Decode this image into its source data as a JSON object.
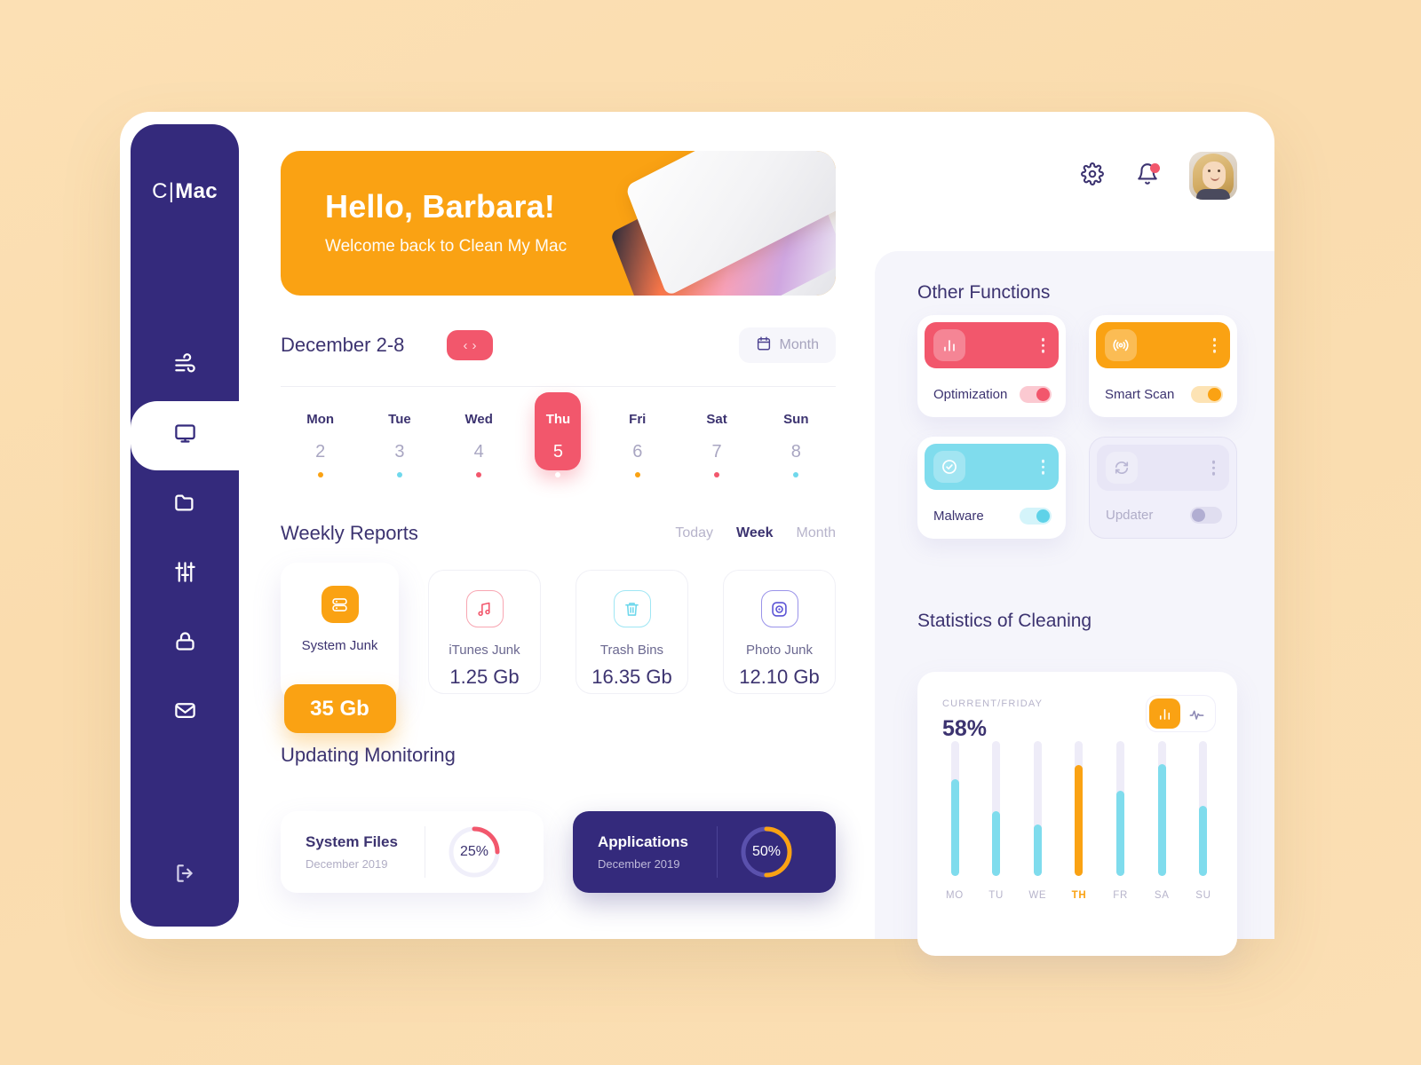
{
  "brand": {
    "prefix": "C",
    "divider": "|",
    "suffix": "Mac"
  },
  "sidebar": {
    "items": [
      {
        "name": "wind-icon",
        "label": "Airflow"
      },
      {
        "name": "monitor-icon",
        "label": "Dashboard"
      },
      {
        "name": "folder-icon",
        "label": "Files"
      },
      {
        "name": "sliders-icon",
        "label": "Settings"
      },
      {
        "name": "lock-icon",
        "label": "Security"
      },
      {
        "name": "mail-icon",
        "label": "Mail"
      }
    ],
    "logout_label": "Log out"
  },
  "banner": {
    "greeting": "Hello, Barbara!",
    "subtitle": "Welcome back to Clean My Mac"
  },
  "topbar": {
    "settings_label": "Settings",
    "notifications_label": "Notifications",
    "avatar_label": "Barbara"
  },
  "date_nav": {
    "range": "December 2-8",
    "prev": "‹",
    "next": "›",
    "month_button": "Month"
  },
  "week": {
    "days": [
      {
        "name": "Mon",
        "num": "2",
        "dot": "#faa213",
        "selected": false
      },
      {
        "name": "Tue",
        "num": "3",
        "dot": "#6fd8ec",
        "selected": false
      },
      {
        "name": "Wed",
        "num": "4",
        "dot": "#f2576c",
        "selected": false
      },
      {
        "name": "Thu",
        "num": "5",
        "dot": "#ffffff",
        "selected": true
      },
      {
        "name": "Fri",
        "num": "6",
        "dot": "#faa213",
        "selected": false
      },
      {
        "name": "Sat",
        "num": "7",
        "dot": "#f2576c",
        "selected": false
      },
      {
        "name": "Sun",
        "num": "8",
        "dot": "#6fd8ec",
        "selected": false
      }
    ]
  },
  "weekly_reports": {
    "title": "Weekly Reports",
    "tabs": [
      {
        "label": "Today",
        "active": false
      },
      {
        "label": "Week",
        "active": true
      },
      {
        "label": "Month",
        "active": false
      }
    ],
    "cards": [
      {
        "label": "System Junk",
        "value": "35 Gb",
        "icon": "server-icon",
        "color": "#faa213",
        "highlight": true
      },
      {
        "label": "iTunes Junk",
        "value": "1.25 Gb",
        "icon": "music-note-icon",
        "color": "#f2576c",
        "highlight": false
      },
      {
        "label": "Trash Bins",
        "value": "16.35 Gb",
        "icon": "trash-icon",
        "color": "#6fd8ec",
        "highlight": false
      },
      {
        "label": "Photo Junk",
        "value": "12.10 Gb",
        "icon": "camera-icon",
        "color": "#5a52d5",
        "highlight": false
      }
    ]
  },
  "updating_monitoring": {
    "title": "Updating Monitoring",
    "cards": [
      {
        "title": "System Files",
        "subtitle": "December 2019",
        "percent": 25,
        "percent_label": "25%",
        "arc_color": "#f2576c",
        "track_color": "#f0effa",
        "theme": "light"
      },
      {
        "title": "Applications",
        "subtitle": "December 2019",
        "percent": 50,
        "percent_label": "50%",
        "arc_color": "#faa213",
        "track_color": "#5a51ad",
        "theme": "dark"
      }
    ]
  },
  "other_functions": {
    "title": "Other Functions",
    "cards": [
      {
        "label": "Optimization",
        "icon": "bar-chart-icon",
        "color": "#f2576c",
        "toggle_on": true,
        "disabled": false,
        "track_color": "#fbc9d1",
        "knob_color": "#f2576c"
      },
      {
        "label": "Smart Scan",
        "icon": "radar-icon",
        "color": "#faa213",
        "toggle_on": true,
        "disabled": false,
        "track_color": "#fde3b4",
        "knob_color": "#faa213"
      },
      {
        "label": "Malware",
        "icon": "check-circle-icon",
        "color": "#7fdced",
        "toggle_on": true,
        "disabled": false,
        "track_color": "#d4f4fa",
        "knob_color": "#5fd2e8"
      },
      {
        "label": "Updater",
        "icon": "refresh-icon",
        "color": "#e8e6f6",
        "toggle_on": false,
        "disabled": true,
        "track_color": "#e0def0",
        "knob_color": "#b1aed2"
      }
    ]
  },
  "statistics": {
    "title": "Statistics of Cleaning",
    "caption": "CURRENT/FRIDAY",
    "percent": "58%",
    "view_toggle": [
      {
        "icon": "bar-chart-icon",
        "active": true
      },
      {
        "icon": "line-chart-icon",
        "active": false
      }
    ]
  },
  "chart_data": {
    "type": "bar",
    "title": "Statistics of Cleaning",
    "categories": [
      "MO",
      "TU",
      "WE",
      "TH",
      "FR",
      "SA",
      "SU"
    ],
    "values": [
      72,
      48,
      38,
      82,
      63,
      83,
      52
    ],
    "highlight_index": 3,
    "bar_color": "#7fdced",
    "highlight_color": "#faa213",
    "track_color": "#eeecf8",
    "ylim": [
      0,
      100
    ],
    "ylabel": "",
    "xlabel": "",
    "grid": false,
    "legend": false,
    "annotation": "58%"
  }
}
